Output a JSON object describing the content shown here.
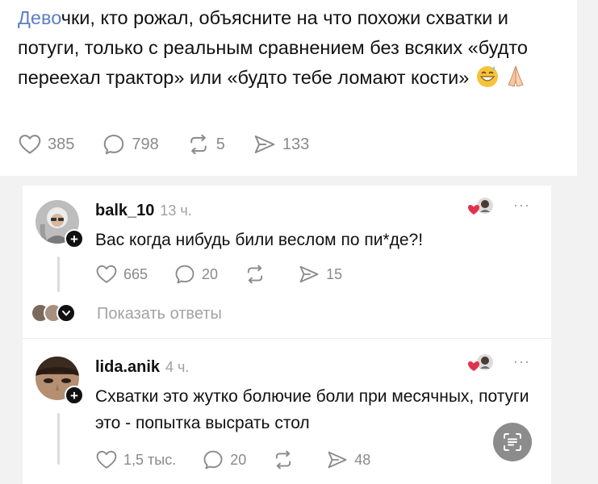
{
  "post": {
    "text_highlight": "Дево",
    "text_rest": "чки, кто рожал, объясните на что похожи схватки и потуги, только с реальным сравнением без всяких «будто переехал трактор» или «будто тебе ломают кости»",
    "emoji_1": "😅",
    "emoji_2": "🙏",
    "likes": "385",
    "comments": "798",
    "reposts": "5",
    "shares": "133"
  },
  "comments": [
    {
      "username": "balk_10",
      "time": "13 ч.",
      "text": "Вас когда нибудь били веслом по пи*де?!",
      "likes": "665",
      "replies": "20",
      "reposts": "",
      "shares": "15",
      "more": "···",
      "plus": "+"
    },
    {
      "username": "lida.anik",
      "time": "4 ч.",
      "text": "Схватки это жутко болючие боли при месячных, потуги это - попытка высрать стол",
      "likes": "1,5 тыс.",
      "replies": "20",
      "reposts": "",
      "shares": "48",
      "more": "···",
      "plus": "+"
    }
  ],
  "show_replies": {
    "label": "Показать ответы",
    "icon": "chevron-down-icon"
  },
  "icons": {
    "like": "heart-icon",
    "comment": "speech-bubble-icon",
    "repost": "repost-arrows-icon",
    "share": "send-icon",
    "more": "more-dots-icon",
    "scan": "text-scan-icon"
  },
  "colors": {
    "highlight": "#5c7fc4",
    "muted": "#8a8a8a",
    "liked_heart": "#e0344c"
  }
}
